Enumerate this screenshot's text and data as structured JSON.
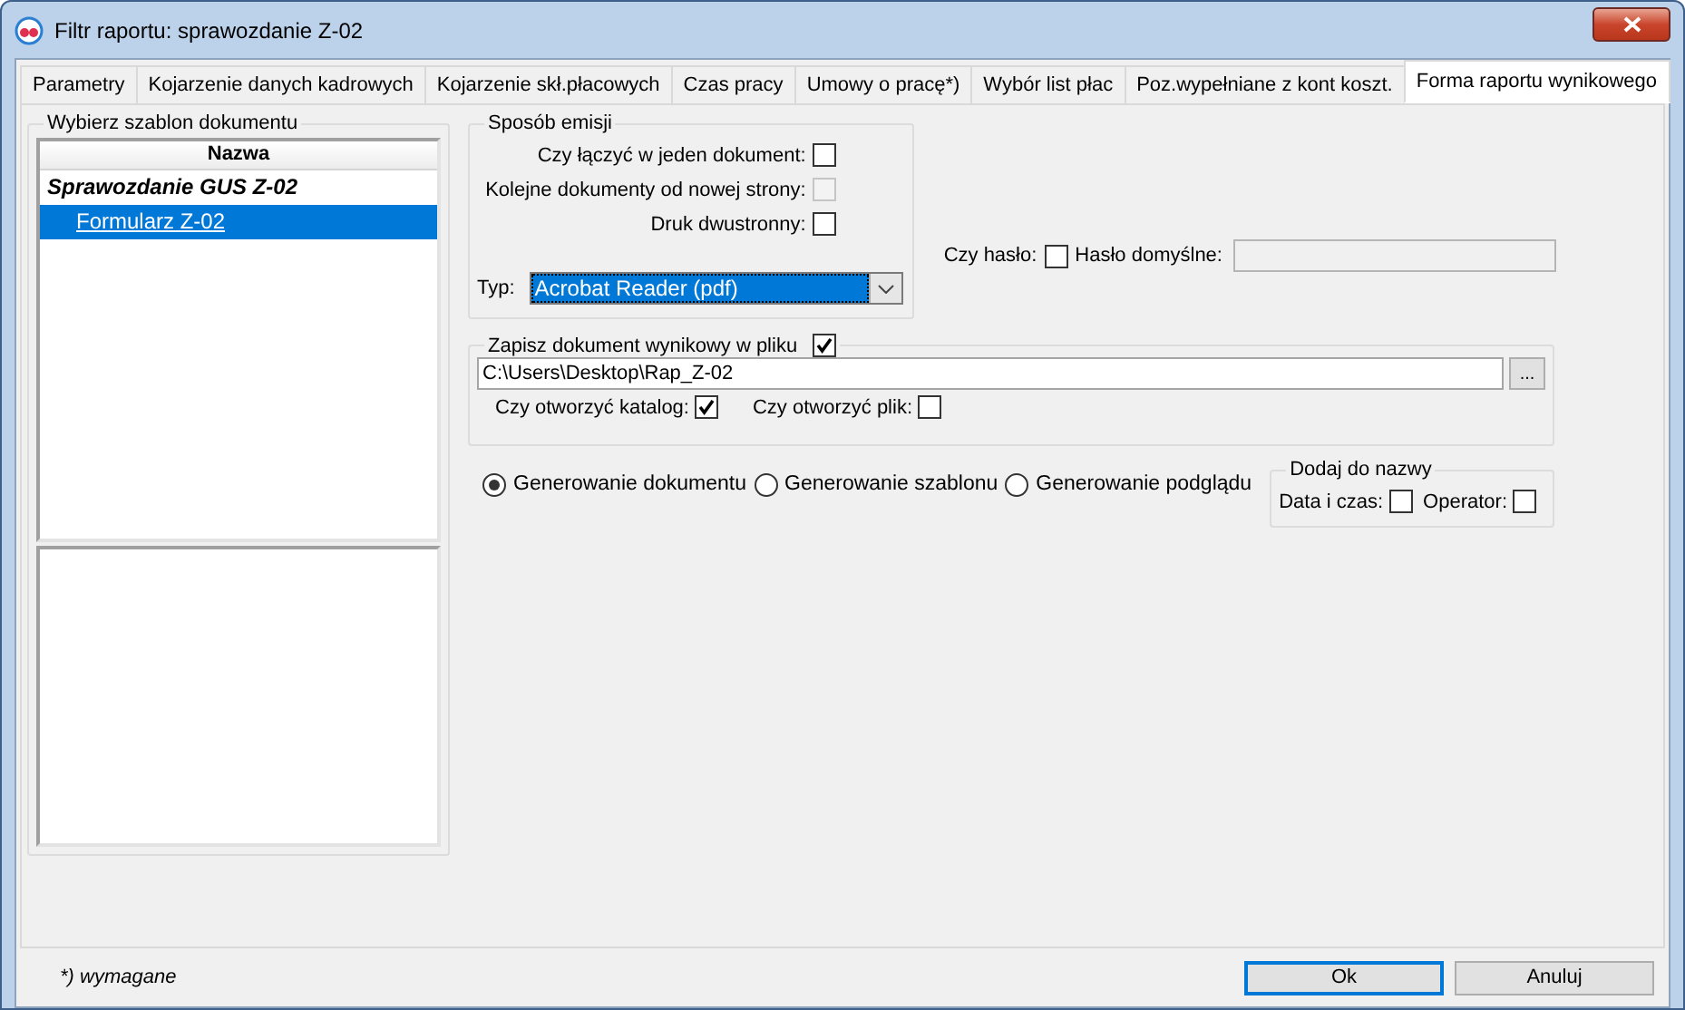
{
  "window": {
    "title": "Filtr raportu: sprawozdanie Z-02"
  },
  "tabs": [
    {
      "label": "Parametry",
      "selected": false
    },
    {
      "label": "Kojarzenie danych kadrowych",
      "selected": false
    },
    {
      "label": "Kojarzenie skł.płacowych",
      "selected": false
    },
    {
      "label": "Czas pracy",
      "selected": false
    },
    {
      "label": "Umowy o pracę*)",
      "selected": false
    },
    {
      "label": "Wybór list płac",
      "selected": false
    },
    {
      "label": "Poz.wypełniane z kont koszt.",
      "selected": false
    },
    {
      "label": "Forma raportu wynikowego",
      "selected": true
    }
  ],
  "template_group": {
    "title": "Wybierz szablon dokumentu",
    "columns": [
      "Nazwa"
    ],
    "tree": [
      {
        "label": "Sprawozdanie GUS Z-02",
        "selected": false,
        "children": [
          {
            "label": "Formularz Z-02",
            "selected": true
          }
        ]
      }
    ]
  },
  "emission": {
    "title": "Sposób emisji",
    "options": [
      {
        "label": "Czy łączyć w jeden dokument:",
        "checked": false,
        "disabled": false
      },
      {
        "label": "Kolejne dokumenty od nowej strony:",
        "checked": false,
        "disabled": true
      },
      {
        "label": "Druk dwustronny:",
        "checked": false,
        "disabled": false
      }
    ],
    "type": {
      "label": "Typ:",
      "value": "Acrobat Reader (pdf)"
    }
  },
  "password": {
    "label": "Czy hasło:",
    "checked": false,
    "default_label": "Hasło domyślne:"
  },
  "save_file": {
    "label": "Zapisz dokument wynikowy w pliku",
    "checked": true,
    "path": "C:\\Users\\Desktop\\Rap_Z-02",
    "browse": "...",
    "options": [
      {
        "label": "Czy otworzyć katalog:",
        "checked": true
      },
      {
        "label": "Czy otworzyć plik:",
        "checked": false
      }
    ]
  },
  "modes": [
    {
      "label": "Generowanie dokumentu",
      "selected": true
    },
    {
      "label": "Generowanie szablonu",
      "selected": false
    },
    {
      "label": "Generowanie podglądu",
      "selected": false
    }
  ],
  "add_to_name": {
    "title": "Dodaj do nazwy",
    "options": [
      {
        "label": "Data i czas:",
        "checked": false
      },
      {
        "label": "Operator:",
        "checked": false
      }
    ]
  },
  "footer": {
    "note": "*) wymagane",
    "buttons": [
      {
        "label": "Ok",
        "default": true
      },
      {
        "label": "Anuluj",
        "default": false
      }
    ]
  }
}
